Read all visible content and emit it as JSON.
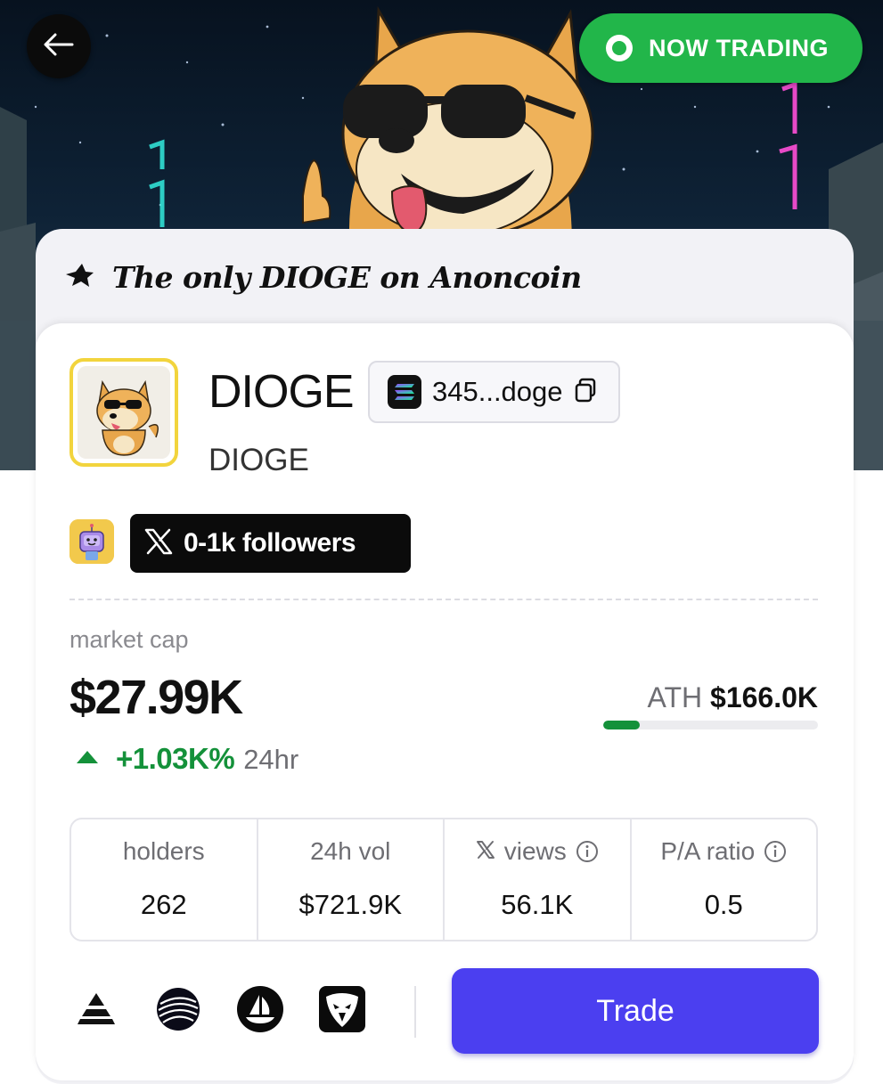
{
  "hero": {
    "back_icon": "arrow-left-icon",
    "status_label": "NOW TRADING",
    "status_color": "#22b64a"
  },
  "tagline": {
    "icon": "star-icon",
    "text": "The only DIOGE on Anoncoin"
  },
  "token": {
    "name": "DIOGE",
    "symbol": "DIOGE",
    "address_short": "345...doge",
    "chain_icon": "solana-icon",
    "copy_icon": "copy-icon"
  },
  "socials": {
    "followers_label": "0-1k followers",
    "x_icon": "x-logo-icon"
  },
  "market": {
    "cap_label": "market cap",
    "cap_value": "$27.99K",
    "change_value": "+1.03K%",
    "change_period": "24hr",
    "ath_label": "ATH",
    "ath_value": "$166.0K",
    "ath_progress_fraction": 0.17,
    "positive_color": "#14913a"
  },
  "stats": [
    {
      "label": "holders",
      "value": "262"
    },
    {
      "label": "24h vol",
      "value": "$721.9K"
    },
    {
      "label": "views",
      "value": "56.1K"
    },
    {
      "label": "P/A ratio",
      "value": "0.5"
    }
  ],
  "bottom": {
    "icons": [
      "pyramid-icon",
      "globe-icon",
      "boat-icon",
      "eagle-icon"
    ],
    "trade_label": "Trade",
    "accent": "#4b3ff0"
  }
}
